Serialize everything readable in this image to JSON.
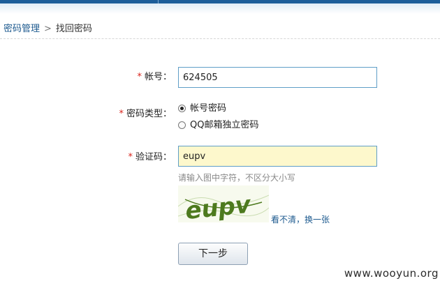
{
  "breadcrumb": {
    "parent": "密码管理",
    "separator": ">",
    "current": "找回密码"
  },
  "form": {
    "required_mark": "*",
    "account": {
      "label": "帐号：",
      "value": "624505"
    },
    "password_type": {
      "label": "密码类型：",
      "options": [
        {
          "label": "帐号密码",
          "checked": true
        },
        {
          "label": "QQ邮箱独立密码",
          "checked": false
        }
      ]
    },
    "captcha": {
      "label": "验证码：",
      "value": "eupv",
      "hint": "请输入图中字符，不区分大小写",
      "image_text": "eupv",
      "refresh_link": "看不清，换一张"
    },
    "next_button": "下一步"
  },
  "watermark": "www.wooyun.org",
  "colors": {
    "header_blue": "#1c5d9a",
    "link_blue": "#1d5a8f",
    "required_red": "#d9231b",
    "input_border": "#5f9ec7",
    "captcha_input_bg": "#fdf8cc",
    "captcha_text_green": "#4d7a1e"
  }
}
